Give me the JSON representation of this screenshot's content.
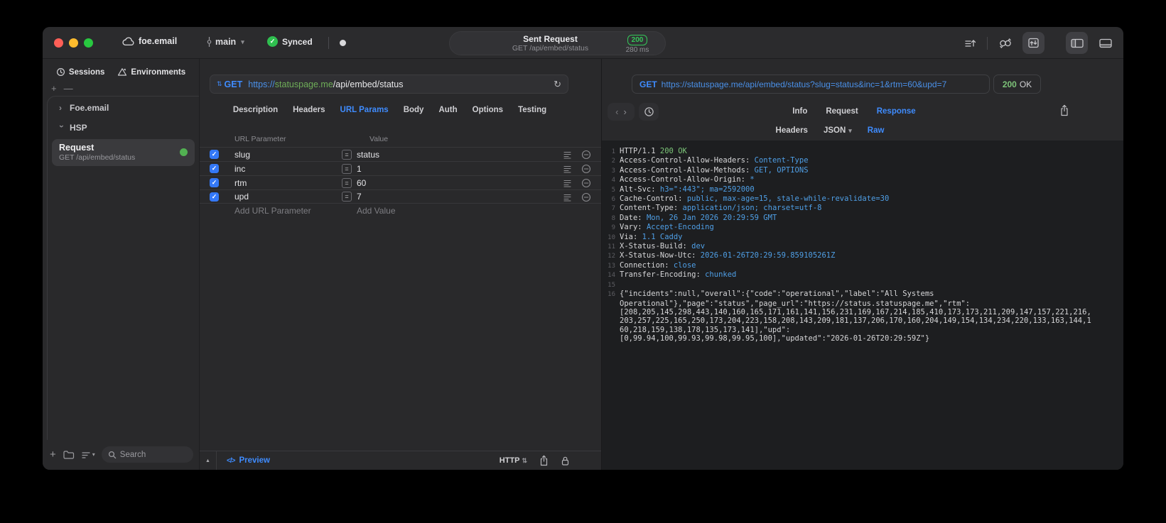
{
  "titlebar": {
    "project": "foe.email",
    "branch": "main",
    "sync_label": "Synced",
    "request_pill": {
      "title": "Sent Request",
      "subtitle": "GET /api/embed/status",
      "status_code": "200",
      "duration": "280 ms"
    }
  },
  "sidebar": {
    "tabs": [
      {
        "label": "Sessions",
        "icon": "clock"
      },
      {
        "label": "Environments",
        "icon": "environments"
      }
    ],
    "tree": [
      {
        "label": "Foe.email",
        "expanded": false
      },
      {
        "label": "HSP",
        "expanded": true
      }
    ],
    "request_item": {
      "title": "Request",
      "subtitle": "GET /api/embed/status"
    },
    "search_placeholder": "Search"
  },
  "request_panel": {
    "method": "GET",
    "url": {
      "scheme": "https://",
      "host": "statuspage.me",
      "path": "/api/embed/status"
    },
    "tabs": [
      "Description",
      "Headers",
      "URL Params",
      "Body",
      "Auth",
      "Options",
      "Testing"
    ],
    "active_tab": "URL Params",
    "params": {
      "col_name": "URL Parameter",
      "col_value": "Value",
      "rows": [
        {
          "name": "slug",
          "value": "status",
          "enabled": true
        },
        {
          "name": "inc",
          "value": "1",
          "enabled": true
        },
        {
          "name": "rtm",
          "value": "60",
          "enabled": true
        },
        {
          "name": "upd",
          "value": "7",
          "enabled": true
        }
      ],
      "add_name": "Add URL Parameter",
      "add_value": "Add Value"
    },
    "footer": {
      "preview_icon": "</>",
      "preview_label": "Preview",
      "protocol": "HTTP"
    }
  },
  "response_panel": {
    "method": "GET",
    "url": "https://statuspage.me/api/embed/status?slug=status&inc=1&rtm=60&upd=7",
    "status_code": "200",
    "status_text": "OK",
    "tabs": [
      "Info",
      "Request",
      "Response"
    ],
    "active_tab": "Response",
    "subtabs": [
      "Headers",
      "JSON",
      "Raw"
    ],
    "active_subtab": "Raw",
    "code_lines": [
      {
        "n": "1",
        "segs": [
          {
            "t": "HTTP/1.1 ",
            "c": "plain"
          },
          {
            "t": "200 OK",
            "c": "green"
          }
        ]
      },
      {
        "n": "2",
        "segs": [
          {
            "t": "Access-Control-Allow-Headers: ",
            "c": "plain"
          },
          {
            "t": "Content-Type",
            "c": "blue"
          }
        ]
      },
      {
        "n": "3",
        "segs": [
          {
            "t": "Access-Control-Allow-Methods: ",
            "c": "plain"
          },
          {
            "t": "GET, OPTIONS",
            "c": "blue"
          }
        ]
      },
      {
        "n": "4",
        "segs": [
          {
            "t": "Access-Control-Allow-Origin: ",
            "c": "plain"
          },
          {
            "t": "*",
            "c": "blue"
          }
        ]
      },
      {
        "n": "5",
        "segs": [
          {
            "t": "Alt-Svc: ",
            "c": "plain"
          },
          {
            "t": "h3=\":443\"; ma=2592000",
            "c": "blue"
          }
        ]
      },
      {
        "n": "6",
        "segs": [
          {
            "t": "Cache-Control: ",
            "c": "plain"
          },
          {
            "t": "public, max-age=15, stale-while-revalidate=30",
            "c": "blue"
          }
        ]
      },
      {
        "n": "7",
        "segs": [
          {
            "t": "Content-Type: ",
            "c": "plain"
          },
          {
            "t": "application/json; charset=utf-8",
            "c": "blue"
          }
        ]
      },
      {
        "n": "8",
        "segs": [
          {
            "t": "Date: ",
            "c": "plain"
          },
          {
            "t": "Mon, 26 Jan 2026 20:29:59 GMT",
            "c": "blue"
          }
        ]
      },
      {
        "n": "9",
        "segs": [
          {
            "t": "Vary: ",
            "c": "plain"
          },
          {
            "t": "Accept-Encoding",
            "c": "blue"
          }
        ]
      },
      {
        "n": "10",
        "segs": [
          {
            "t": "Via: ",
            "c": "plain"
          },
          {
            "t": "1.1 Caddy",
            "c": "blue"
          }
        ]
      },
      {
        "n": "11",
        "segs": [
          {
            "t": "X-Status-Build: ",
            "c": "plain"
          },
          {
            "t": "dev",
            "c": "blue"
          }
        ]
      },
      {
        "n": "12",
        "segs": [
          {
            "t": "X-Status-Now-Utc: ",
            "c": "plain"
          },
          {
            "t": "2026-01-26T20:29:59.859105261Z",
            "c": "blue"
          }
        ]
      },
      {
        "n": "13",
        "segs": [
          {
            "t": "Connection: ",
            "c": "plain"
          },
          {
            "t": "close",
            "c": "blue"
          }
        ]
      },
      {
        "n": "14",
        "segs": [
          {
            "t": "Transfer-Encoding: ",
            "c": "plain"
          },
          {
            "t": "chunked",
            "c": "blue"
          }
        ]
      },
      {
        "n": "15",
        "segs": []
      },
      {
        "n": "16",
        "segs": [
          {
            "t": "{\"incidents\":null,\"overall\":{\"code\":\"operational\",\"label\":\"All Systems",
            "c": "plain"
          }
        ]
      },
      {
        "n": "",
        "segs": [
          {
            "t": "Operational\"},\"page\":\"status\",\"page_url\":\"https://status.statuspage.me\",\"rtm\":",
            "c": "plain"
          }
        ]
      },
      {
        "n": "",
        "segs": [
          {
            "t": "[208,205,145,298,443,140,160,165,171,161,141,156,231,169,167,214,185,410,173,173,211,209,147,157,221,216,",
            "c": "plain"
          }
        ]
      },
      {
        "n": "",
        "segs": [
          {
            "t": "203,257,225,165,250,173,204,223,158,208,143,209,181,137,206,170,160,204,149,154,134,234,220,133,163,144,1",
            "c": "plain"
          }
        ]
      },
      {
        "n": "",
        "segs": [
          {
            "t": "60,218,159,138,178,135,173,141],\"upd\":",
            "c": "plain"
          }
        ]
      },
      {
        "n": "",
        "segs": [
          {
            "t": "[0,99.94,100,99.93,99.98,99.95,100],\"updated\":\"2026-01-26T20:29:59Z\"}",
            "c": "plain"
          }
        ]
      }
    ]
  },
  "accents": {
    "accent_blue": "#3f8cff",
    "macos_green": "#28c840",
    "macos_yellow": "#febc2e",
    "macos_red": "#ff5f57",
    "value_blue": "#4f9fe6",
    "status_green": "#7dc379"
  }
}
